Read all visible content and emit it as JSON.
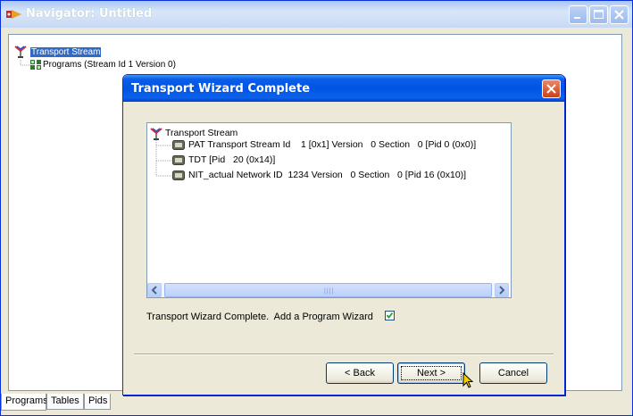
{
  "window": {
    "title": "Navigator: Untitled"
  },
  "tree": {
    "root": "Transport Stream",
    "child": "Programs (Stream Id 1 Version 0)"
  },
  "tabs": [
    {
      "label": "Programs"
    },
    {
      "label": "Tables"
    },
    {
      "label": "Pids"
    }
  ],
  "dialog": {
    "title": "Transport Wizard Complete",
    "list": {
      "root": "Transport Stream",
      "items": [
        {
          "text": "PAT Transport Stream Id    1 [0x1] Version   0 Section   0 [Pid 0 (0x0)]"
        },
        {
          "text": "TDT [Pid   20 (0x14)]"
        },
        {
          "text": "NIT_actual Network ID  1234 Version   0 Section   0 [Pid 16 (0x10)]"
        }
      ]
    },
    "checkbox_label": "Transport Wizard Complete.  Add a Program Wizard",
    "checkbox_checked": true,
    "buttons": {
      "back": "< Back",
      "next": "Next >",
      "cancel": "Cancel"
    }
  },
  "colors": {
    "dialog_title": "#0054e3",
    "selection": "#316ac5"
  }
}
